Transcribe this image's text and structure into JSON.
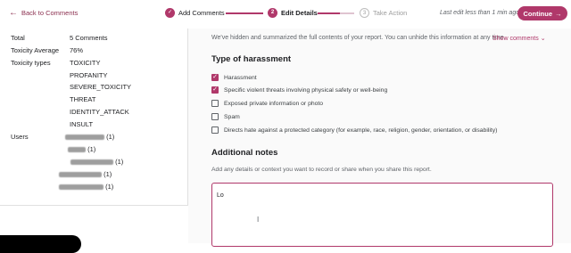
{
  "topbar": {
    "back_label": "Back to Comments",
    "steps": [
      {
        "num": "✓",
        "label": "Add Comments",
        "state": "done"
      },
      {
        "num": "2",
        "label": "Edit Details",
        "state": "current"
      },
      {
        "num": "3",
        "label": "Take Action",
        "state": "todo"
      }
    ],
    "last_edit": "Last edit less than 1 min ago",
    "continue_label": "Continue",
    "accent_color": "#b0386a"
  },
  "summary": {
    "total_label": "Total",
    "total_value": "5 Comments",
    "avg_label": "Toxicity Average",
    "avg_value": "76%",
    "types_label": "Toxicity types",
    "types": [
      "TOXICITY",
      "PROFANITY",
      "SEVERE_TOXICITY",
      "THREAT",
      "IDENTITY_ATTACK",
      "INSULT"
    ],
    "users_label": "Users",
    "user_counts": [
      "(1)",
      "(1)",
      "(1)",
      "(1)",
      "(1)"
    ]
  },
  "details": {
    "notice": "We've hidden and summarized the full contents of your report. You can unhide this information at any time.",
    "show_comments": "Show comments",
    "harassment_title": "Type of harassment",
    "options": [
      {
        "label": "Harassment",
        "checked": true
      },
      {
        "label": "Specific violent threats involving physical safety or well-being",
        "checked": true
      },
      {
        "label": "Exposed private information or photo",
        "checked": false
      },
      {
        "label": "Spam",
        "checked": false
      },
      {
        "label": "Directs hate against a protected category (for example, race, religion, gender, orientation, or disability)",
        "checked": false
      }
    ],
    "notes_title": "Additional notes",
    "notes_hint": "Add any details or context you want to record or share when you share this report.",
    "notes_value": "Lo"
  }
}
